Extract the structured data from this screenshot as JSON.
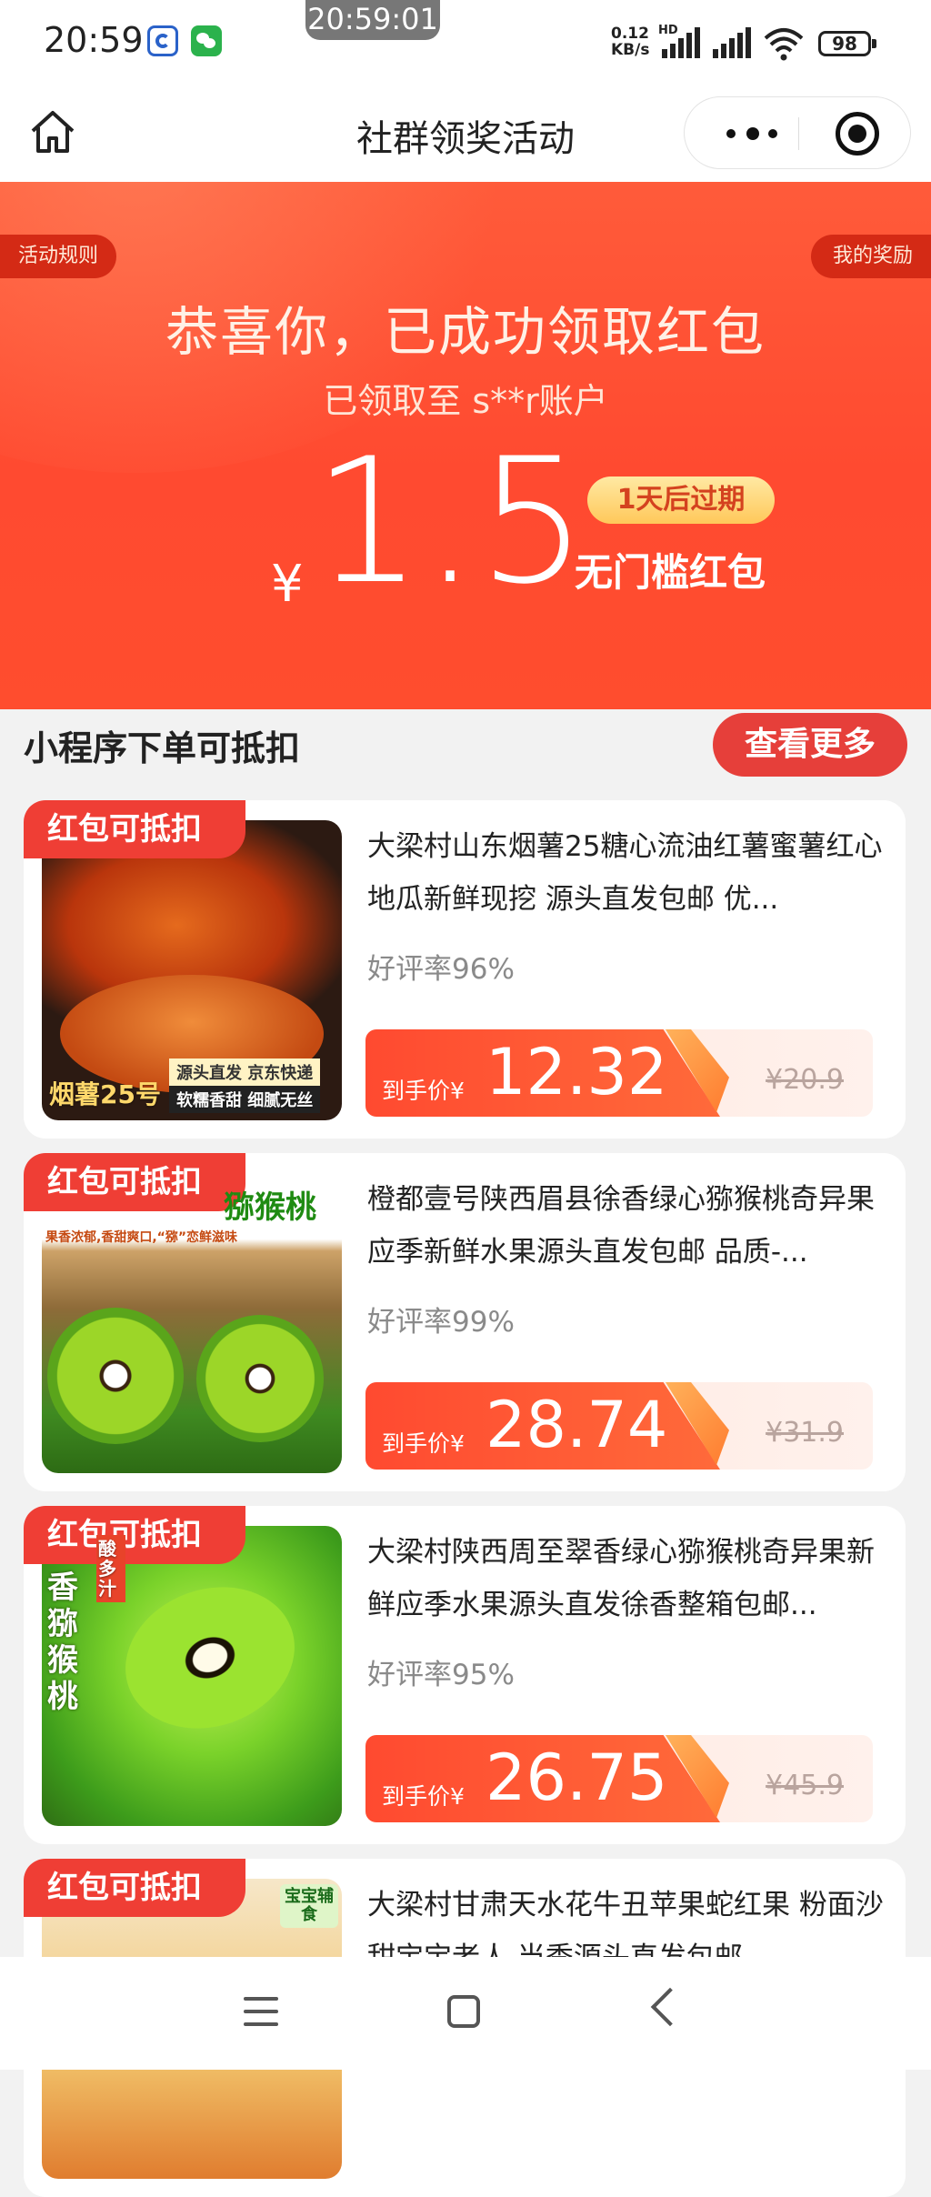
{
  "status_bar": {
    "time": "20:59",
    "clock_overlay": "20:59:01",
    "net_speed_value": "0.12",
    "net_speed_unit": "KB/s",
    "net_type": "HD",
    "battery": "98"
  },
  "navbar": {
    "title": "社群领奖活动",
    "home_icon": "home-icon",
    "more_icon": "more-dots-icon",
    "close_icon": "target-circle-icon"
  },
  "banner": {
    "rules_label": "活动规则",
    "rewards_label": "我的奖励",
    "congrats": "恭喜你，已成功领取红包",
    "account": "已领取至 s**r账户",
    "currency": "¥",
    "amount": "1.5",
    "expire": "1天后过期",
    "coupon_type": "无门槛红包",
    "colors": {
      "primary": "#ff4a30",
      "gold": "#ffc85a"
    }
  },
  "section": {
    "title": "小程序下单可抵扣",
    "more_label": "查看更多"
  },
  "products": [
    {
      "badge": "红包可抵扣",
      "title": "大梁村山东烟薯25糖心流油红薯蜜薯红心地瓜新鲜现挖 源头直发包邮 优...",
      "rating": "好评率96%",
      "price_label": "到手价¥",
      "price": "12.32",
      "original_price": "¥20.9",
      "thumb_text": [
        "烟薯25号",
        "源头直发 京东快递",
        "软糯香甜 细腻无丝"
      ]
    },
    {
      "badge": "红包可抵扣",
      "title": "橙都壹号陕西眉县徐香绿心猕猴桃奇异果 应季新鲜水果源头直发包邮 品质-...",
      "rating": "好评率99%",
      "price_label": "到手价¥",
      "price": "28.74",
      "original_price": "¥31.9",
      "thumb_text": [
        "猕猴桃",
        "果香浓郁,香甜爽口,“猕”恋鲜滋味"
      ]
    },
    {
      "badge": "红包可抵扣",
      "title": "大梁村陕西周至翠香绿心猕猴桃奇异果新鲜应季水果源头直发徐香整箱包邮...",
      "rating": "好评率95%",
      "price_label": "到手价¥",
      "price": "26.75",
      "original_price": "¥45.9",
      "thumb_text": [
        "香猕猴桃",
        "酸多汁"
      ]
    },
    {
      "badge": "红包可抵扣",
      "title": "大梁村甘肃天水花牛丑苹果蛇红果 粉面沙甜宝宝老人 当季源头直发包邮",
      "thumb_text": [
        "宝宝辅食"
      ]
    }
  ]
}
